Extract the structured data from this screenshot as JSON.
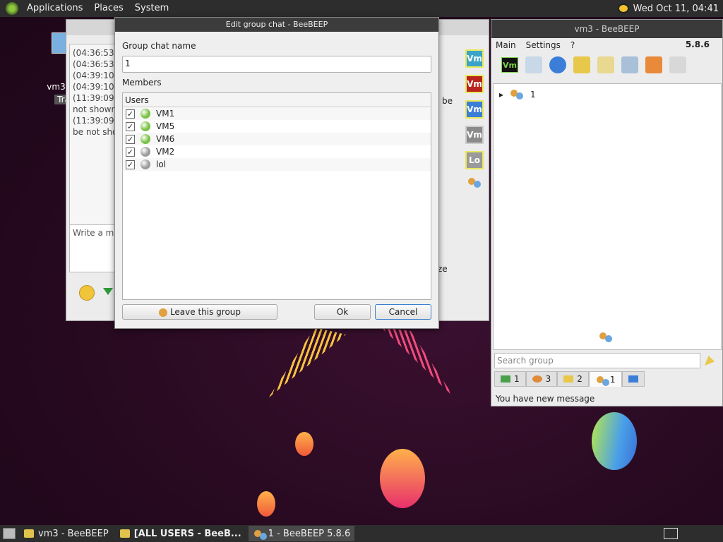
{
  "top_panel": {
    "menus": [
      "Applications",
      "Places",
      "System"
    ],
    "clock": "Wed Oct 11, 04:41"
  },
  "desktop_icon": {
    "label": "vm3's h",
    "label2": "Tra"
  },
  "chat_window": {
    "log_lines": [
      "(04:36:53)",
      "(04:36:53)",
      "(04:39:10)",
      "(04:39:10)",
      "(11:39:09)",
      "not shown",
      "(11:39:09)",
      "be not sho"
    ],
    "side_text": "be",
    "input_placeholder": "Write a me",
    "size_label": "ze",
    "side_badges": [
      "Vm",
      "Vm",
      "Vm",
      "Vm",
      "Lo"
    ]
  },
  "edit_dialog": {
    "title": "Edit group chat - BeeBEEP",
    "name_label": "Group chat name",
    "name_value": "1",
    "members_label": "Members",
    "users_header": "Users",
    "members": [
      {
        "name": "VM1",
        "checked": true,
        "status_color": "#79c142"
      },
      {
        "name": "VM5",
        "checked": true,
        "status_color": "#79c142"
      },
      {
        "name": "VM6",
        "checked": true,
        "status_color": "#79c142"
      },
      {
        "name": "VM2",
        "checked": true,
        "status_color": "#9a9a9a"
      },
      {
        "name": "lol",
        "checked": true,
        "status_color": "#9a9a9a"
      }
    ],
    "leave_label": "Leave this group",
    "ok_label": "Ok",
    "cancel_label": "Cancel",
    "check_mark": "✓"
  },
  "main_window": {
    "title": "vm3 - BeeBEEP",
    "menus": [
      "Main",
      "Settings",
      "?"
    ],
    "version": "5.8.6",
    "vm_badge": "Vm",
    "tree_item": "1",
    "tree_expand": "▸",
    "search_placeholder": "Search group",
    "tabs": [
      {
        "label": "1",
        "icon": "user-icon"
      },
      {
        "label": "3",
        "icon": "users-icon"
      },
      {
        "label": "2",
        "icon": "chat-icon"
      },
      {
        "label": "1",
        "icon": "group-icon"
      },
      {
        "label": "",
        "icon": "network-icon"
      }
    ],
    "status": "You have new message"
  },
  "taskbar": {
    "tasks": [
      {
        "label": "vm3 - BeeBEEP",
        "active": false
      },
      {
        "label": "[ALL USERS - BeeB...",
        "active": false,
        "bold": true
      },
      {
        "label": "1 - BeeBEEP 5.8.6",
        "active": true
      }
    ]
  },
  "colors": {
    "online": "#79c142",
    "offline": "#9a9a9a",
    "focus": "#3a7fd0"
  }
}
